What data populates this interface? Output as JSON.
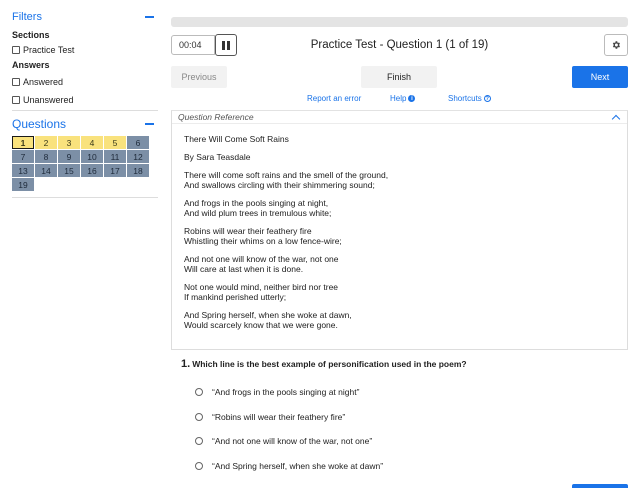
{
  "sidebar": {
    "filters_title": "Filters",
    "sections_label": "Sections",
    "sections": [
      {
        "label": "Practice Test"
      }
    ],
    "answers_label": "Answers",
    "answers": [
      {
        "label": "Answered"
      },
      {
        "label": "Unanswered"
      }
    ],
    "questions_title": "Questions",
    "questions": [
      {
        "n": "1",
        "state": "current"
      },
      {
        "n": "2",
        "state": "yellow"
      },
      {
        "n": "3",
        "state": "yellow"
      },
      {
        "n": "4",
        "state": "yellow"
      },
      {
        "n": "5",
        "state": "yellow"
      },
      {
        "n": "6",
        "state": "gray"
      },
      {
        "n": "7",
        "state": "gray"
      },
      {
        "n": "8",
        "state": "gray"
      },
      {
        "n": "9",
        "state": "gray"
      },
      {
        "n": "10",
        "state": "gray"
      },
      {
        "n": "11",
        "state": "gray"
      },
      {
        "n": "12",
        "state": "gray"
      },
      {
        "n": "13",
        "state": "gray"
      },
      {
        "n": "14",
        "state": "gray"
      },
      {
        "n": "15",
        "state": "gray"
      },
      {
        "n": "16",
        "state": "gray"
      },
      {
        "n": "17",
        "state": "gray"
      },
      {
        "n": "18",
        "state": "gray"
      },
      {
        "n": "19",
        "state": "gray"
      }
    ]
  },
  "toolbar": {
    "timer": "00:04",
    "title": "Practice Test - Question 1 (1 of 19)"
  },
  "nav": {
    "previous": "Previous",
    "finish": "Finish",
    "next": "Next"
  },
  "links": {
    "report": "Report an error",
    "help": "Help",
    "shortcuts": "Shortcuts"
  },
  "reference": {
    "header": "Question Reference",
    "title": "There Will Come Soft Rains",
    "author": "By Sara Teasdale",
    "stanzas": [
      [
        "There will come soft rains and the smell of the ground,",
        "And swallows circling with their shimmering sound;"
      ],
      [
        "And frogs in the pools singing at night,",
        "And wild plum trees in tremulous white;"
      ],
      [
        "Robins will wear their feathery fire",
        "Whistling their whims on a low fence-wire;"
      ],
      [
        "And not one will know of the war, not one",
        "Will care at last when it is done."
      ],
      [
        "Not one would mind, neither bird nor tree",
        "If mankind perished utterly;"
      ],
      [
        "And Spring herself, when she woke at dawn,",
        "Would scarcely know that we were gone."
      ]
    ]
  },
  "question": {
    "number": "1.",
    "stem": "Which line is the best example of personification used in the poem?",
    "options": [
      "“And frogs in the pools singing at night”",
      "“Robins will wear their feathery fire”",
      "“And not one will know of the war, not one”",
      "“And Spring herself, when she woke at dawn”"
    ]
  },
  "colors": {
    "accent": "#1a73e8",
    "answered_cell": "#f9e27d",
    "unanswered_cell": "#7c8fa6"
  }
}
